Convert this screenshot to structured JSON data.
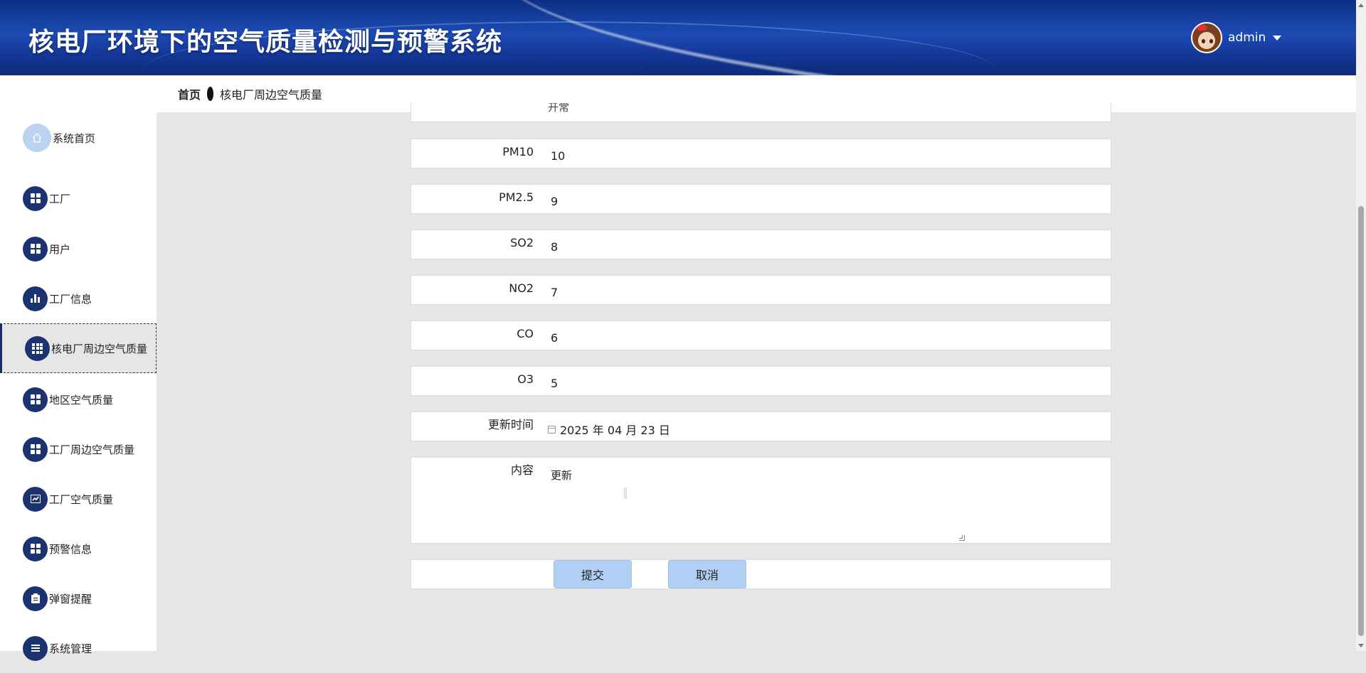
{
  "header": {
    "title": "核电厂环境下的空气质量检测与预警系统",
    "username": "admin"
  },
  "breadcrumb": {
    "home": "首页",
    "current": "核电厂周边空气质量"
  },
  "sidebar": {
    "items": [
      {
        "label": "系统首页",
        "icon": "home-icon"
      },
      {
        "label": "工厂",
        "icon": "grid-icon"
      },
      {
        "label": "用户",
        "icon": "grid-icon"
      },
      {
        "label": "工厂信息",
        "icon": "bar-chart-icon"
      },
      {
        "label": "核电厂周边空气质量",
        "icon": "table-icon",
        "active": true
      },
      {
        "label": "地区空气质量",
        "icon": "grid-icon"
      },
      {
        "label": "工厂周边空气质量",
        "icon": "grid-icon"
      },
      {
        "label": "工厂空气质量",
        "icon": "line-chart-icon"
      },
      {
        "label": "预警信息",
        "icon": "grid-icon"
      },
      {
        "label": "弹窗提醒",
        "icon": "clipboard-icon"
      },
      {
        "label": "系统管理",
        "icon": "list-icon"
      }
    ]
  },
  "form": {
    "partial_top_value": "开常",
    "fields": [
      {
        "label": "PM10",
        "value": "10"
      },
      {
        "label": "PM2.5",
        "value": "9"
      },
      {
        "label": "SO2",
        "value": "8"
      },
      {
        "label": "NO2",
        "value": "7"
      },
      {
        "label": "CO",
        "value": "6"
      },
      {
        "label": "O3",
        "value": "5"
      }
    ],
    "update_time": {
      "label": "更新时间",
      "value": "2025 年 04 月 23 日"
    },
    "content": {
      "label": "内容",
      "value": "更新"
    },
    "submit_label": "提交",
    "cancel_label": "取消"
  }
}
